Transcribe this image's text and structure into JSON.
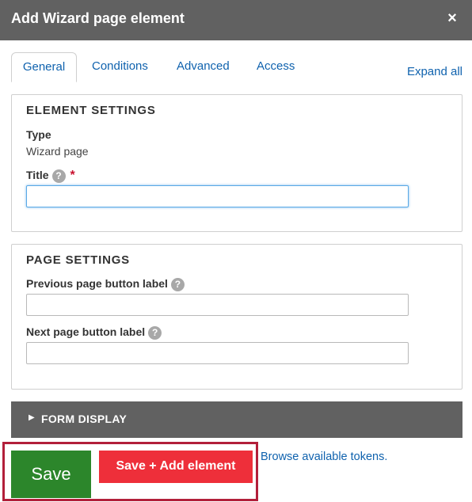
{
  "dialog": {
    "title": "Add Wizard page element",
    "close_label": "×"
  },
  "tabs": [
    {
      "label": "General",
      "active": true
    },
    {
      "label": "Conditions",
      "active": false
    },
    {
      "label": "Advanced",
      "active": false
    },
    {
      "label": "Access",
      "active": false
    }
  ],
  "expand_all": "Expand all",
  "element_settings": {
    "heading": "ELEMENT SETTINGS",
    "type_label": "Type",
    "type_value": "Wizard page",
    "title_label": "Title",
    "title_required_mark": "*",
    "title_value": "",
    "help_glyph": "?"
  },
  "page_settings": {
    "heading": "PAGE SETTINGS",
    "prev_label": "Previous page button label",
    "prev_value": "",
    "next_label": "Next page button label",
    "next_value": "",
    "help_glyph": "?"
  },
  "form_display": {
    "arrow": "▶",
    "label": "FORM DISPLAY"
  },
  "actions": {
    "save_label": "Save",
    "save_add_label": "Save + Add element",
    "tokens_link": "Browse available tokens."
  },
  "colors": {
    "header_bg": "#616161",
    "link": "#0f62ae",
    "save_bg": "#2c862b",
    "save_add_bg": "#ee2f3a",
    "highlight_border": "#b21f3a",
    "required": "#c8102e"
  },
  "icons": {
    "close": "close-icon",
    "help": "help-icon",
    "disclosure": "triangle-right-icon"
  }
}
